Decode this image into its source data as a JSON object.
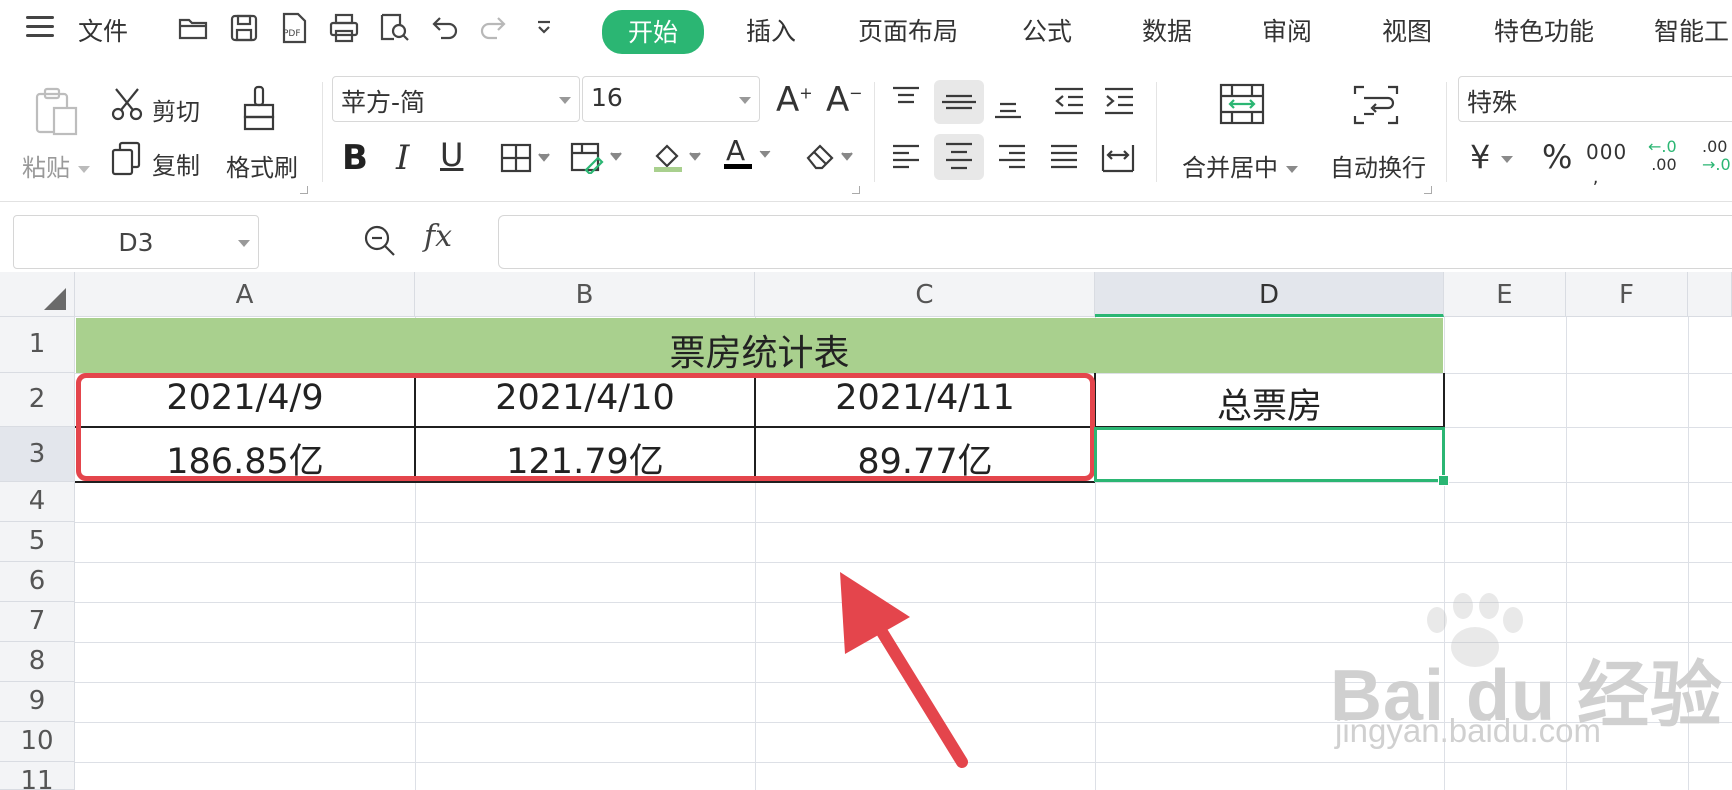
{
  "menu": {
    "file_label": "文件",
    "tabs": [
      {
        "label": "开始",
        "active": true
      },
      {
        "label": "插入",
        "active": false
      },
      {
        "label": "页面布局",
        "active": false
      },
      {
        "label": "公式",
        "active": false
      },
      {
        "label": "数据",
        "active": false
      },
      {
        "label": "审阅",
        "active": false
      },
      {
        "label": "视图",
        "active": false
      },
      {
        "label": "特色功能",
        "active": false
      },
      {
        "label": "智能工",
        "active": false
      }
    ],
    "quick_access_icons": [
      "open-folder-icon",
      "save-icon",
      "export-pdf-icon",
      "print-icon",
      "print-preview-icon",
      "undo-icon",
      "redo-icon",
      "more-dropdown-icon"
    ],
    "pdf_text": "PDF"
  },
  "ribbon": {
    "paste_label": "粘贴",
    "cut_label": "剪切",
    "copy_label": "复制",
    "format_painter_label": "格式刷",
    "font_name": "苹方-简",
    "font_size": "16",
    "merge_center_label": "合并居中",
    "wrap_text_label": "自动换行",
    "number_format": "特殊",
    "currency_symbol": "¥",
    "percent_symbol": "%",
    "thousands_symbol": "000",
    "bold_glyph": "B",
    "italic_glyph": "I",
    "underline_glyph": "U",
    "grow_font_glyph": "A",
    "shrink_font_glyph": "A",
    "font_color_glyph": "A",
    "font_color": "#000000",
    "fill_color": "#a9d08e",
    "inc_decimal_top": "←.0",
    "inc_decimal_bottom": ".00",
    "dec_decimal_top": ".00",
    "dec_decimal_bottom": "→.0"
  },
  "formula_bar": {
    "name_box": "D3",
    "fx_label": "fx",
    "formula": ""
  },
  "sheet": {
    "columns": [
      "A",
      "B",
      "C",
      "D",
      "E",
      "F"
    ],
    "selected_column": "D",
    "rows": [
      "1",
      "2",
      "3",
      "4",
      "5",
      "6",
      "7",
      "8",
      "9",
      "10",
      "11"
    ],
    "selected_row": "3",
    "title": "票房统计表",
    "header_row": [
      "2021/4/9",
      "2021/4/10",
      "2021/4/11",
      "总票房"
    ],
    "value_row": [
      "186.85亿",
      "121.79亿",
      "89.77亿",
      ""
    ],
    "title_fill_color": "#a9d08e",
    "annotation_color": "#e4454c",
    "selection_color": "#2bb673"
  },
  "watermark": {
    "brand_text": "Bai du 经验",
    "url_text": "jingyan.baidu.com"
  }
}
